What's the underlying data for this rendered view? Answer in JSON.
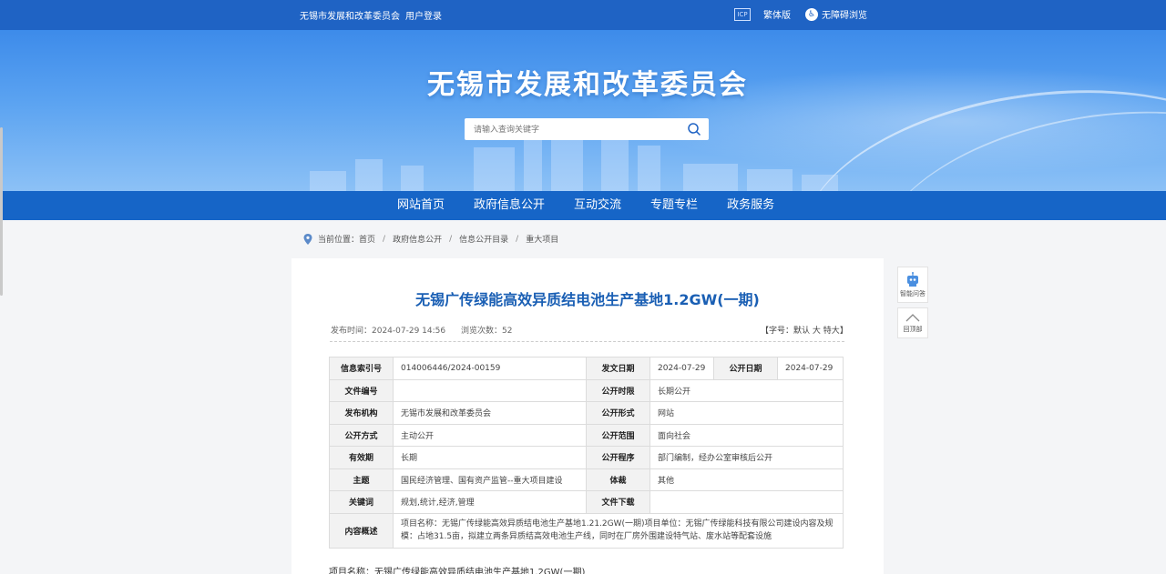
{
  "topbar": {
    "org_link": "无锡市发展和改革委员会",
    "login": "用户登录",
    "qr_icon_text": "ICP",
    "traditional": "繁体版",
    "accessible": "无障碍浏览"
  },
  "banner": {
    "title": "无锡市发展和改革委员会"
  },
  "search": {
    "placeholder": "请输入查询关键字"
  },
  "nav": {
    "items": [
      "网站首页",
      "政府信息公开",
      "互动交流",
      "专题专栏",
      "政务服务"
    ]
  },
  "breadcrumb": {
    "prefix": "当前位置：",
    "items": [
      "首页",
      "政府信息公开",
      "信息公开目录",
      "重大项目"
    ],
    "separator": "/"
  },
  "article": {
    "title": "无锡广传绿能高效异质结电池生产基地1.2GW(一期)",
    "publish_time": "发布时间：2024-07-29 14:56",
    "views": "浏览次数：52",
    "font_size_label_open": "【字号：",
    "font_default": "默认",
    "font_large": "大",
    "font_xlarge": "特大",
    "font_size_label_close": "】",
    "info": {
      "index_label": "信息索引号",
      "index_value": "014006446/2024-00159",
      "doc_date_label": "发文日期",
      "doc_date_value": "2024-07-29",
      "pub_date_label": "公开日期",
      "pub_date_value": "2024-07-29",
      "doc_no_label": "文件编号",
      "doc_no_value": "",
      "pub_time_label": "公开时限",
      "pub_time_value": "长期公开",
      "org_label": "发布机构",
      "org_value": "无锡市发展和改革委员会",
      "pub_form_label": "公开形式",
      "pub_form_value": "网站",
      "pub_method_label": "公开方式",
      "pub_method_value": "主动公开",
      "pub_scope_label": "公开范围",
      "pub_scope_value": "面向社会",
      "valid_label": "有效期",
      "valid_value": "长期",
      "pub_proc_label": "公开程序",
      "pub_proc_value": "部门编制，经办公室审核后公开",
      "topic_label": "主题",
      "topic_value": "国民经济管理、国有资产监管--重大项目建设",
      "genre_label": "体裁",
      "genre_value": "其他",
      "keywords_label": "关键词",
      "keywords_value": "规划,统计,经济,管理",
      "download_label": "文件下载",
      "download_value": "",
      "summary_label": "内容概述",
      "summary_value": "项目名称：无锡广传绿能高效异质结电池生产基地1.21.2GW(一期)项目单位：无锡广传绿能科技有限公司建设内容及规模：占地31.5亩，拟建立两条异质结高效电池生产线，同时在厂房外围建设特气站、废水站等配套设施"
    },
    "body_first_line": "项目名称：无锡广传绿能高效异质结电池生产基地1.2GW(一期)"
  },
  "side_tools": {
    "ai_label": "智能问答",
    "top_label": "回顶部"
  },
  "colors": {
    "topbar": "#1f63c4",
    "nav": "#1665c7",
    "title_blue": "#1a5fb4"
  }
}
